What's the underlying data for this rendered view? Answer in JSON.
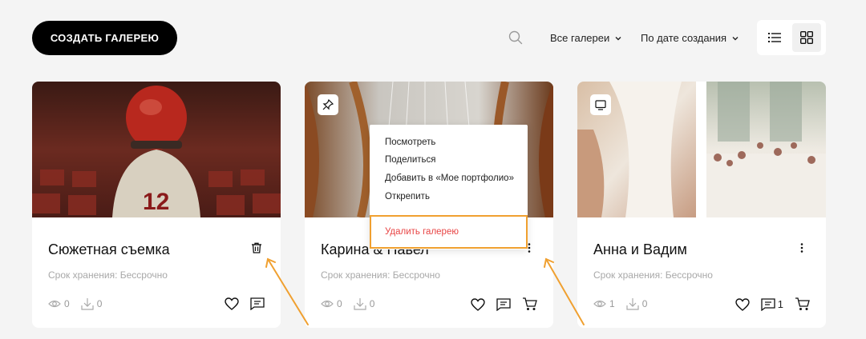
{
  "toolbar": {
    "create_label": "СОЗДАТЬ ГАЛЕРЕЮ",
    "filter_galleries": "Все галереи",
    "filter_sort": "По дате создания"
  },
  "cards": [
    {
      "title": "Сюжетная съемка",
      "term": "Срок хранения: Бессрочно",
      "views": "0",
      "downloads": "0"
    },
    {
      "title": "Карина & Павел",
      "term": "Срок хранения: Бессрочно",
      "views": "0",
      "downloads": "0"
    },
    {
      "title": "Анна и Вадим",
      "term": "Срок хранения: Бессрочно",
      "views": "1",
      "downloads": "0",
      "comments": "1"
    }
  ],
  "context_menu": {
    "items": [
      "Посмотреть",
      "Поделиться",
      "Добавить в «Мое портфолио»",
      "Открепить"
    ],
    "delete_label": "Удалить галерею"
  },
  "colors": {
    "accent_highlight": "#f0a030",
    "danger": "#e84545"
  }
}
